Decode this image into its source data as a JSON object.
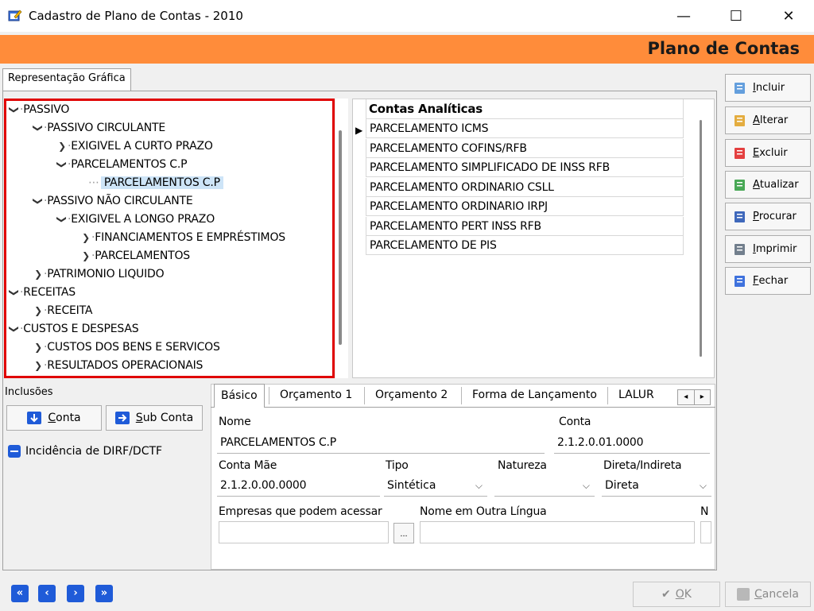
{
  "window": {
    "title": "Cadastro de Plano de Contas - 2010",
    "minimize": "—",
    "maximize": "☐",
    "close": "✕"
  },
  "header": {
    "title": "Plano de Contas"
  },
  "tab": {
    "label": "Representação Gráfica"
  },
  "tree": {
    "nodes": [
      {
        "label": "PASSIVO",
        "arrow": "❯",
        "expanded": true
      },
      {
        "label": "PASSIVO CIRCULANTE",
        "arrow": "❯",
        "expanded": true
      },
      {
        "label": "EXIGIVEL A CURTO PRAZO",
        "arrow": "❯",
        "expanded": false
      },
      {
        "label": "PARCELAMENTOS C.P",
        "arrow": "❯",
        "expanded": true
      },
      {
        "label": "PARCELAMENTOS C.P",
        "selected": true
      },
      {
        "label": "PASSIVO NÃO CIRCULANTE",
        "arrow": "❯",
        "expanded": true
      },
      {
        "label": "EXIGIVEL A LONGO PRAZO",
        "arrow": "❯",
        "expanded": true
      },
      {
        "label": "FINANCIAMENTOS E EMPRÉSTIMOS",
        "arrow": "❯",
        "expanded": false
      },
      {
        "label": "PARCELAMENTOS",
        "arrow": "❯",
        "expanded": false
      },
      {
        "label": "PATRIMONIO LIQUIDO",
        "arrow": "❯",
        "expanded": false
      },
      {
        "label": "RECEITAS",
        "arrow": "❯",
        "expanded": true
      },
      {
        "label": "RECEITA",
        "arrow": "❯",
        "expanded": false
      },
      {
        "label": "CUSTOS E DESPESAS",
        "arrow": "❯",
        "expanded": true
      },
      {
        "label": "CUSTOS DOS BENS E SERVICOS",
        "arrow": "❯",
        "expanded": false
      },
      {
        "label": "RESULTADOS OPERACIONAIS",
        "arrow": "❯",
        "expanded": false
      }
    ]
  },
  "grid": {
    "header": "Contas Analíticas",
    "indicator": "▶",
    "rows": [
      "PARCELAMENTO ICMS",
      "PARCELAMENTO COFINS/RFB",
      "PARCELAMENTO SIMPLIFICADO DE INSS RFB",
      "PARCELAMENTO ORDINARIO CSLL",
      "PARCELAMENTO ORDINARIO IRPJ",
      "PARCELAMENTO PERT INSS RFB",
      "PARCELAMENTO DE PIS"
    ]
  },
  "side_buttons": [
    {
      "hotkey": "I",
      "rest": "ncluir",
      "icon": "document-icon",
      "color": "#4a8fd8"
    },
    {
      "hotkey": "A",
      "rest": "lterar",
      "icon": "edit-icon",
      "color": "#e0a020"
    },
    {
      "hotkey": "E",
      "rest": "xcluir",
      "icon": "delete-icon",
      "color": "#e02020"
    },
    {
      "hotkey": "A",
      "rest": "tualizar",
      "icon": "refresh-icon",
      "color": "#2a9a3a"
    },
    {
      "hotkey": "P",
      "rest": "rocurar",
      "icon": "binoculars-icon",
      "color": "#1f4fb0"
    },
    {
      "hotkey": "I",
      "rest": "mprimir",
      "icon": "printer-icon",
      "color": "#5a6a7a"
    },
    {
      "hotkey": "F",
      "rest": "echar",
      "icon": "exit-icon",
      "color": "#1f5bd8"
    }
  ],
  "inclusoes": {
    "label": "Inclusões",
    "conta_hotkey": "C",
    "conta_rest": "onta",
    "subconta_hotkey": "S",
    "subconta_rest": "ub Conta",
    "checkbox_label": "Incidência de DIRF/DCTF"
  },
  "detail_tabs": [
    "Básico",
    "Orçamento 1",
    "Orçamento 2",
    "Forma de Lançamento",
    "LALUR"
  ],
  "tab_scroll": {
    "left": "◂",
    "right": "▸"
  },
  "form": {
    "nome_label": "Nome",
    "nome_value": "PARCELAMENTOS C.P",
    "conta_label": "Conta",
    "conta_value": "2.1.2.0.01.0000",
    "conta_mae_label": "Conta Mãe",
    "conta_mae_value": "2.1.2.0.00.0000",
    "tipo_label": "Tipo",
    "tipo_value": "Sintética",
    "natureza_label": "Natureza",
    "natureza_value": "",
    "direta_label": "Direta/Indireta",
    "direta_value": "Direta",
    "empresas_label": "Empresas que podem acessar",
    "empresas_value": "",
    "ellipsis": "...",
    "outra_lingua_label": "Nome em Outra Língua",
    "outra_lingua_value": "",
    "n_label": "N"
  },
  "footer": {
    "nav": [
      "«",
      "‹",
      "›",
      "»"
    ],
    "ok_hotkey": "O",
    "ok_rest": "K",
    "ok_icon": "✔",
    "cancel_hotkey": "C",
    "cancel_rest": "ancela"
  }
}
